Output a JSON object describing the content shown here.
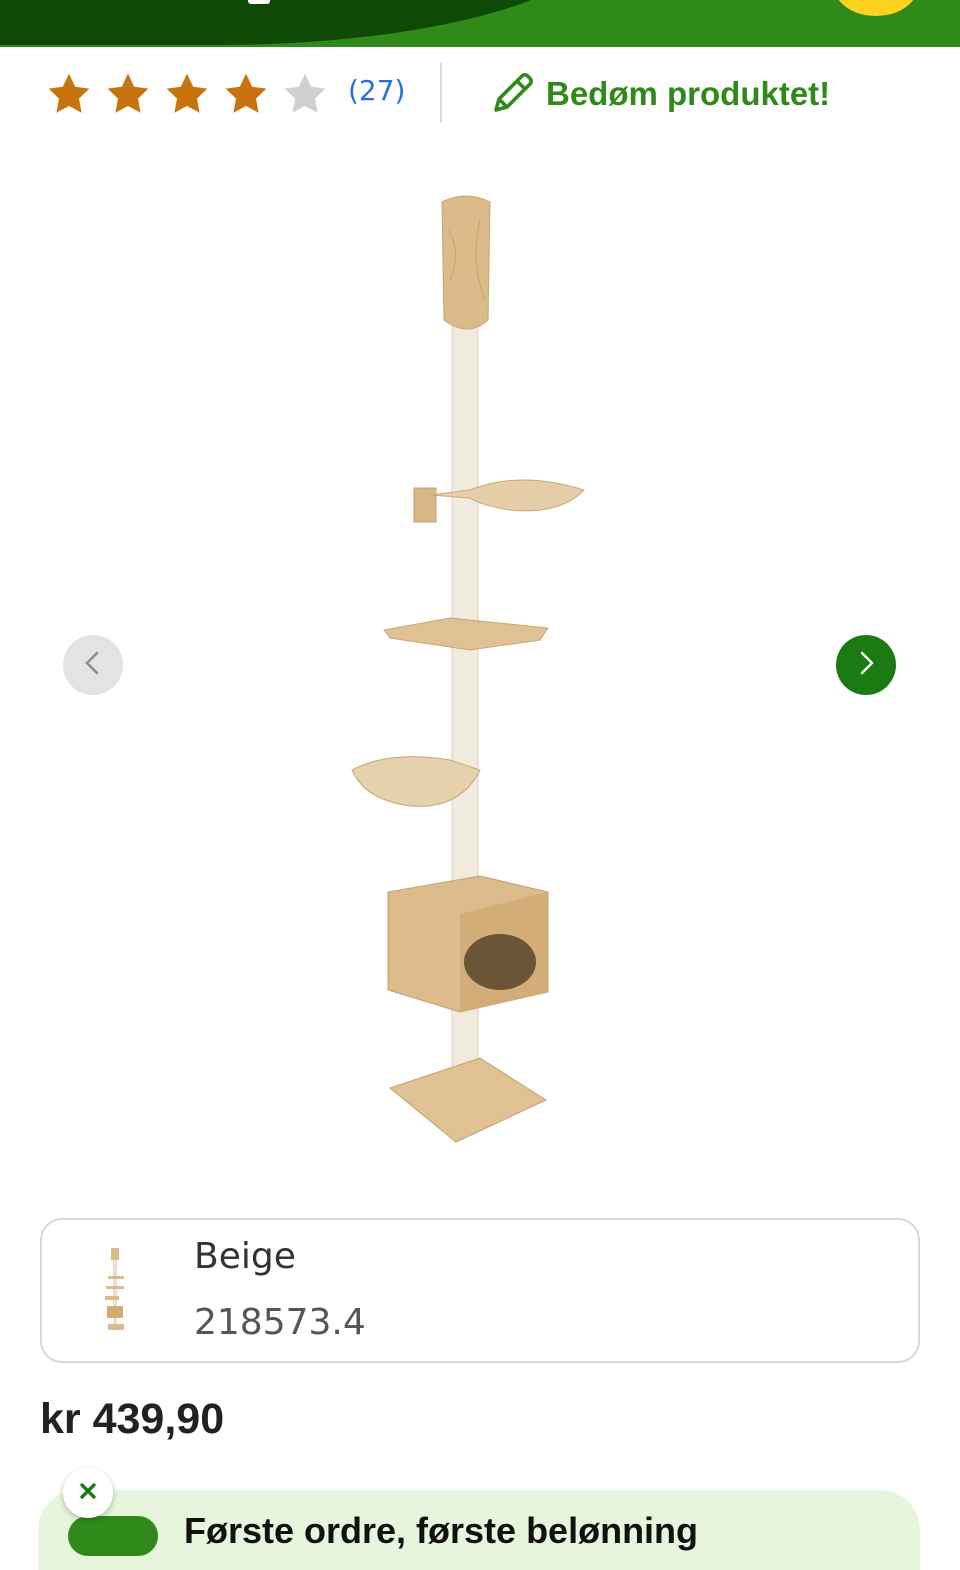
{
  "header": {
    "brand_color": "#2f8a1a",
    "dark_color": "#0e4a06",
    "cart_color": "#ffd21f"
  },
  "rating": {
    "stars_filled": 4,
    "stars_total": 5,
    "review_count": "(27)",
    "star_color": "#c7730f",
    "empty_star_color": "#d0d0d0",
    "rate_label": "Bedøm produktet!",
    "rate_icon": "pencil-icon"
  },
  "carousel": {
    "prev_icon": "chevron-left-icon",
    "next_icon": "chevron-right-icon",
    "next_color": "#1c7a12"
  },
  "variant": {
    "name": "Beige",
    "sku": "218573.4"
  },
  "price": "kr 439,90",
  "promo": {
    "text": "Første ordre, første belønning",
    "close_icon": "close-icon"
  }
}
